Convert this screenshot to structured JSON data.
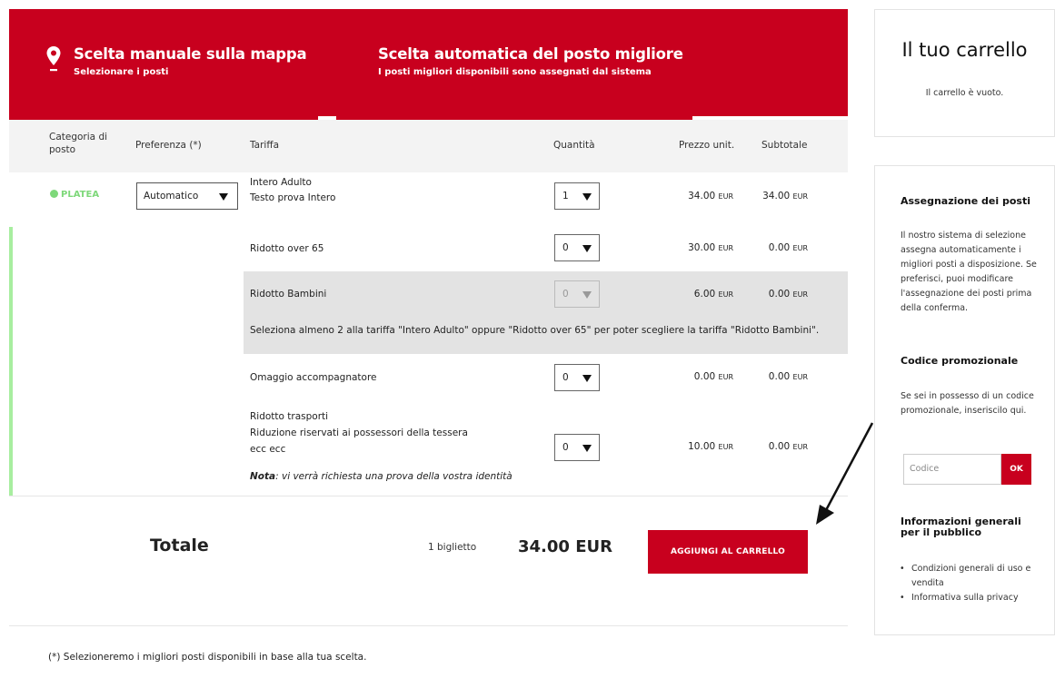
{
  "header": {
    "manual_title": "Scelta manuale sulla mappa",
    "manual_subtitle": "Selezionare i posti",
    "auto_title": "Scelta automatica del posto migliore",
    "auto_subtitle": "I posti migliori disponibili sono assegnati dal sistema",
    "icons": {
      "manual": "map-pin-icon"
    }
  },
  "table": {
    "headers": {
      "category": "Categoria di posto",
      "preference": "Preferenza (*)",
      "tariff": "Tariffa",
      "quantity": "Quantità",
      "unit_price": "Prezzo unit.",
      "subtotal": "Subtotale"
    },
    "category": "PLATEA",
    "preference_value": "Automatico",
    "currency": "EUR",
    "rows": [
      {
        "name": "Intero Adulto",
        "description": "Testo prova Intero",
        "qty": "1",
        "unit": "34.00",
        "subtotal": "34.00"
      },
      {
        "name": "Ridotto over 65",
        "qty": "0",
        "unit": "30.00",
        "subtotal": "0.00"
      },
      {
        "name": "Ridotto Bambini",
        "qty": "0",
        "unit": "6.00",
        "subtotal": "0.00",
        "disabled": true
      },
      {
        "name": "Omaggio accompagnatore",
        "qty": "0",
        "unit": "0.00",
        "subtotal": "0.00"
      },
      {
        "name": "Ridotto trasporti",
        "description_1": "Riduzione riservati ai possessori della tessera",
        "description_2": "ecc ecc",
        "qty": "0",
        "unit": "10.00",
        "subtotal": "0.00"
      }
    ],
    "bambini_notice": "Seleziona almeno 2 alla tariffa \"Intero Adulto\" oppure \"Ridotto over 65\" per poter scegliere la tariffa \"Ridotto Bambini\".",
    "nota_label": "Nota",
    "nota_text": ": vi verrà richiesta una prova della vostra identità"
  },
  "totals": {
    "label": "Totale",
    "tickets": "1 biglietto",
    "amount": "34.00 EUR",
    "add_button": "AGGIUNGI AL CARRELLO"
  },
  "footnote": "(*) Selezioneremo i migliori posti disponibili in base alla tua scelta.",
  "cart": {
    "title": "Il tuo carrello",
    "empty": "Il carrello è vuoto."
  },
  "sidebar": {
    "assignment_title": "Assegnazione dei posti",
    "assignment_text": "Il nostro sistema di selezione assegna automaticamente i migliori posti a disposizione. Se preferisci, puoi modificare l'assegnazione dei posti prima della conferma.",
    "promo_title": "Codice promozionale",
    "promo_text": "Se sei in possesso di un codice promozionale, inseriscilo qui.",
    "promo_placeholder": "Codice",
    "promo_button": "OK",
    "info_title": "Informazioni generali per il pubblico",
    "links": [
      "Condizioni generali di uso e vendita",
      "Informativa sulla privacy"
    ]
  },
  "colors": {
    "brand_red": "#c8001e",
    "category_green": "#7ed87a",
    "disabled_row": "#e3e3e3"
  }
}
